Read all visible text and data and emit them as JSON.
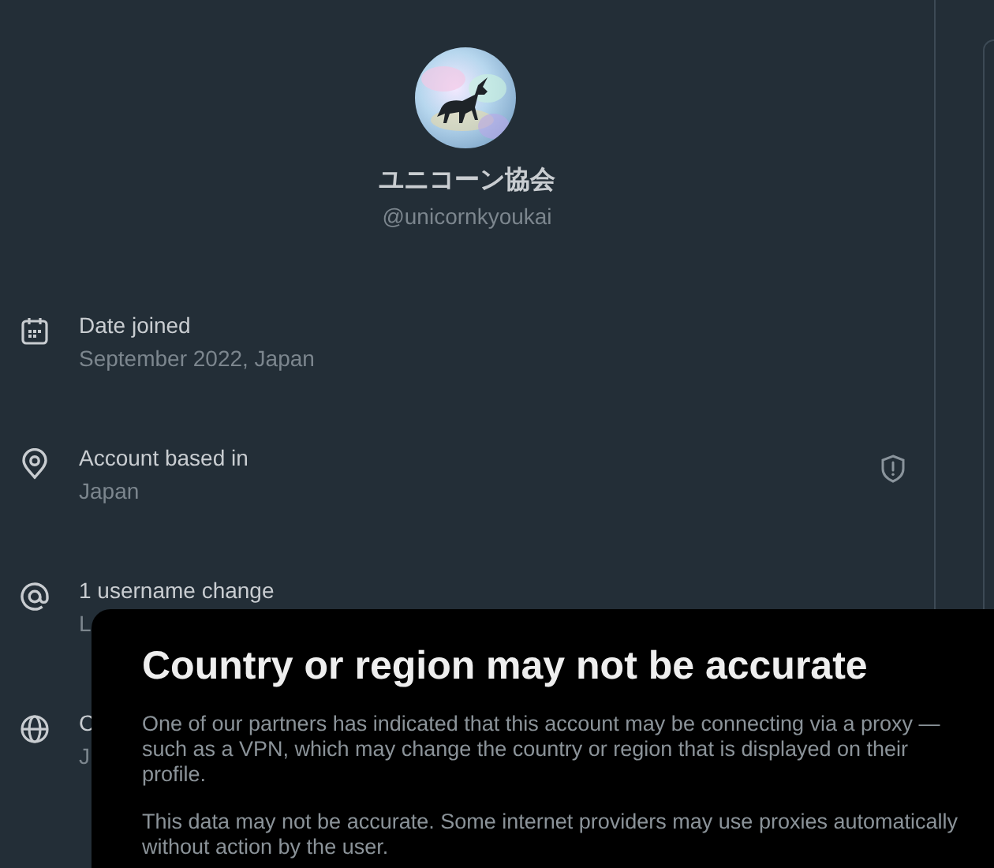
{
  "profile": {
    "display_name": "ユニコーン協会",
    "handle": "@unicornkyoukai"
  },
  "details": [
    {
      "kind": "calendar",
      "label": "Date joined",
      "value": "September 2022, Japan",
      "warning": false
    },
    {
      "kind": "location",
      "label": "Account based in",
      "value": "Japan",
      "warning": true
    },
    {
      "kind": "at",
      "label": "1 username change",
      "value": "L",
      "warning": false
    },
    {
      "kind": "globe",
      "label": "C",
      "value": "J"
    }
  ],
  "dialog": {
    "title": "Country or region may not be accurate",
    "paragraphs": [
      "One of our partners has indicated that this account may be connecting via a proxy — such as a VPN, which may change the country or region that is displayed on their profile.",
      "This data may not be accurate. Some internet providers may use proxies automatically without action by the user."
    ]
  }
}
